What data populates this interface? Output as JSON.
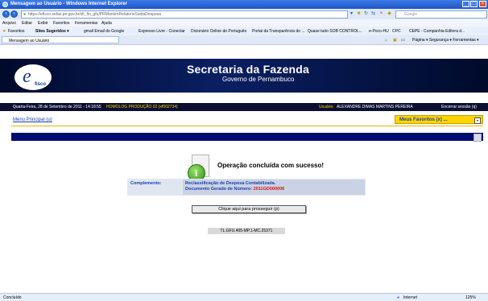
{
  "window": {
    "title": "Mensagem ao Usuário - Windows Internet Explorer"
  },
  "address_bar": {
    "url": "https://efisco.sefaz.pe.gov.br/sfi_fin_gfu/PRMantenRelatorioSaidaDespesa",
    "search_placeholder": "Google"
  },
  "menu": {
    "items": [
      "Arquivo",
      "Editar",
      "Exibir",
      "Favoritos",
      "Ferramentas",
      "Ajuda"
    ]
  },
  "favorites_bar": {
    "label": "Favoritos",
    "links": [
      "Sites Sugeridos ▾",
      "gmail Email do Google",
      "Expresso Livre - Conectar",
      "Dicionário Online de Português",
      "Portal da Transparência do ...",
      "Quase tudo SOB CONTROL...",
      "e-Poco-HU",
      "CPC",
      "CEPE - Companhia Editora d..."
    ]
  },
  "tab": {
    "label": "Mensagem ao Usuário",
    "right_tools": "Página ▾   Segurança ▾   Ferramentas ▾"
  },
  "banner": {
    "logo_text": "fisco",
    "title": "Secretaria da Fazenda",
    "subtitle": "Governo de Pernambuco"
  },
  "info_bar": {
    "date": "Quarta-Feira, 28 de Setembro de 2011 - 14:18:55",
    "environment": "HOMOLOG PRODUÇÃO 02 (xf002734)",
    "user_label": "Usuário:",
    "user_name": "ALEXANDRE DIMAS MARTINS PEREIRA",
    "logout": "Encerrar sessão (q)"
  },
  "content": {
    "main_menu": "Menu Principal (u)",
    "favorites_menu": "Meus Favoritos (x) ...",
    "success_message": "Operação concluída com sucesso!",
    "complement_label": "Complemento:",
    "complement_line1": "Reclassificação de Despesa Contabilizada.",
    "complement_line2_prefix": "Documento Gerado de Número:",
    "document_number": "2011GD000006",
    "continue_button": "Clique aqui para prosseguir (p)",
    "screen_code": "TL.GFU.405-MP.1-MC.25371"
  },
  "status_bar": {
    "left": "Concluído",
    "zone": "Internet",
    "zoom": "125%"
  },
  "colors": {
    "banner": "#0a1f63",
    "info_bar": "#0b0f30",
    "environment_text": "#ffd400",
    "favorites_dropdown": "#ffd400",
    "blue_bar": "#000c6e",
    "document_number": "#e01010",
    "link": "#1d3fa8"
  }
}
